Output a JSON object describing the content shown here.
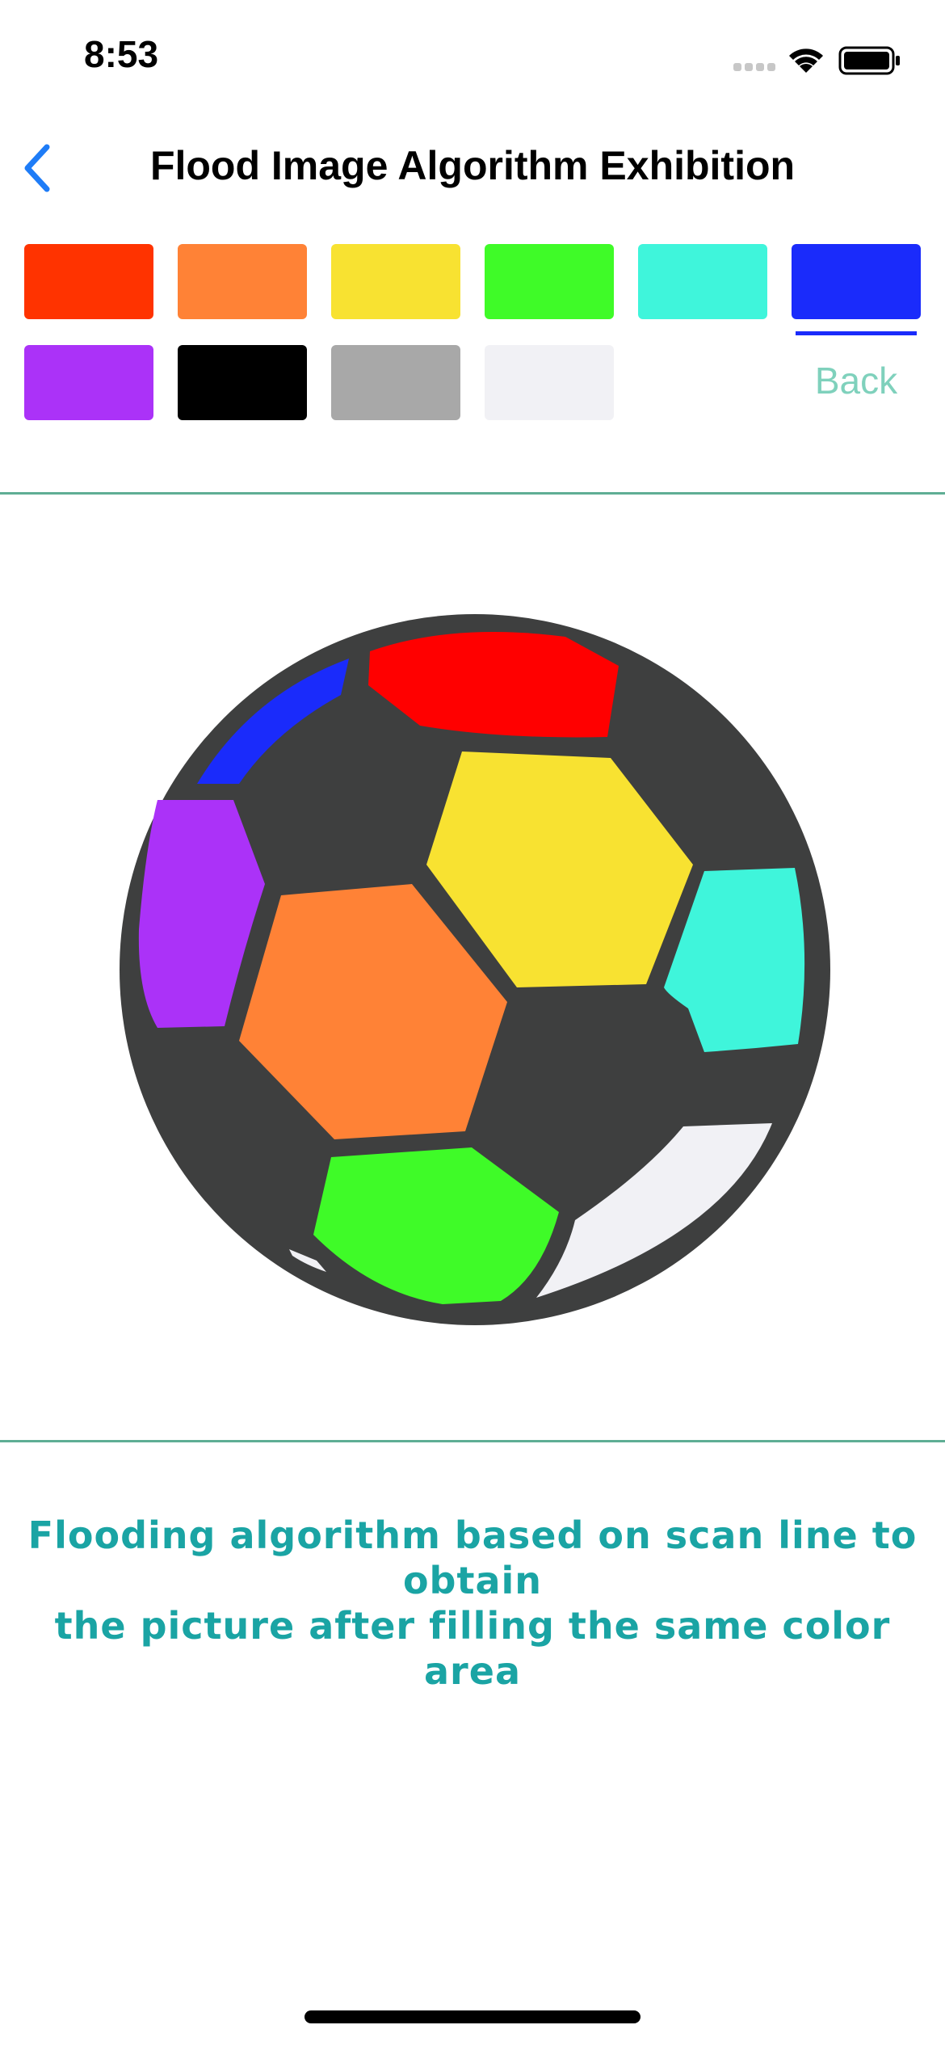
{
  "status_bar": {
    "time": "8:53",
    "icons": [
      "cellular-dots-icon",
      "wifi-icon",
      "battery-icon"
    ]
  },
  "nav": {
    "back_icon": "chevron-left-icon",
    "title": "Flood Image Algorithm Exhibition"
  },
  "palette": {
    "colors": [
      "#ff3300",
      "#ff8236",
      "#f8e231",
      "#3ffb28",
      "#3ff5db",
      "#1a2bfb",
      "#ab32f8",
      "#000000",
      "#a8a8a8",
      "#f1f1f5"
    ],
    "selected_color": "#1a2bfb",
    "back_label": "Back"
  },
  "canvas": {
    "subject": "soccer ball",
    "outline_color": "#3e3f3f",
    "patch_colors": {
      "top": "#ff0000",
      "top_left_strip": "#1a2bfb",
      "left": "#ab32f8",
      "upper_center": "#f8e231",
      "center": "#ff8236",
      "right": "#3ff5db",
      "bottom": "#3ffb28",
      "bottom_right": "#f1f1f5"
    }
  },
  "caption": {
    "line1": "Flooding algorithm based on scan line to obtain",
    "line2": "the picture after filling the same color area"
  }
}
